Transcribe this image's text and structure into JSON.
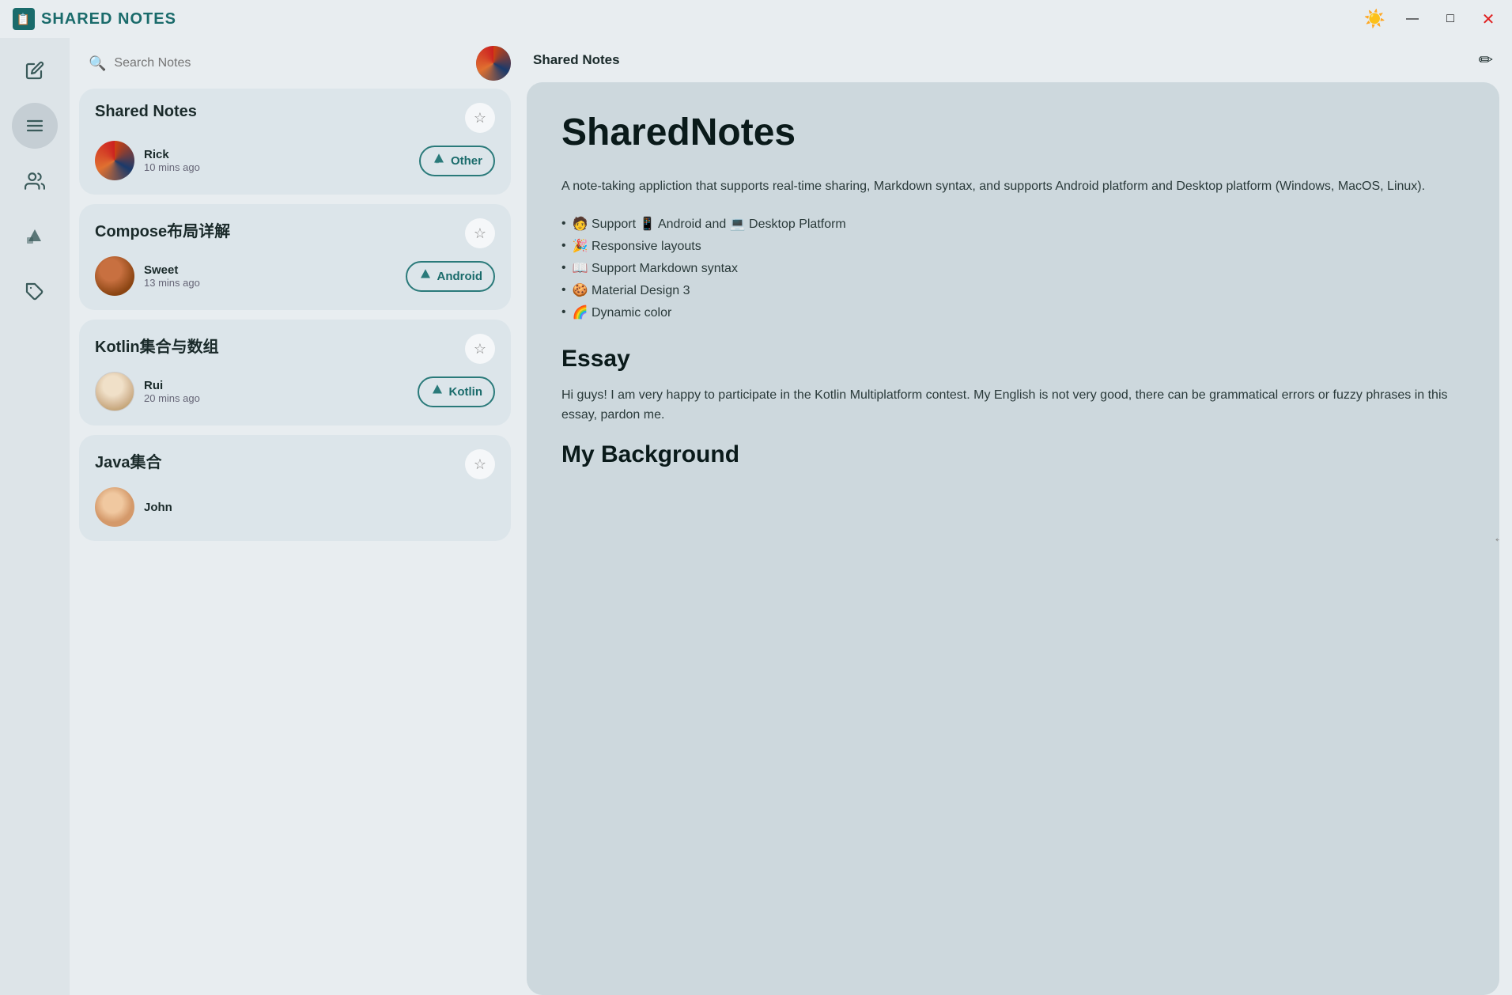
{
  "titleBar": {
    "title": "SHARED NOTES",
    "controls": {
      "minimize": "—",
      "maximize": "□",
      "close": "✕"
    }
  },
  "sidebar": {
    "items": [
      {
        "name": "edit-icon",
        "icon": "✏️",
        "active": false
      },
      {
        "name": "notes-list-icon",
        "icon": "☰",
        "active": true
      },
      {
        "name": "people-icon",
        "icon": "👥",
        "active": false
      },
      {
        "name": "shapes-icon",
        "icon": "🔺",
        "active": false
      },
      {
        "name": "tag-icon",
        "icon": "🏷️",
        "active": false
      }
    ]
  },
  "search": {
    "placeholder": "Search Notes"
  },
  "notes": [
    {
      "id": "note-1",
      "title": "Shared Notes",
      "author": "Rick",
      "time": "10 mins ago",
      "tag": "Other",
      "avatarClass": "avatar-rick",
      "active": true
    },
    {
      "id": "note-2",
      "title": "Compose布局详解",
      "author": "Sweet",
      "time": "13 mins ago",
      "tag": "Android",
      "avatarClass": "avatar-sweet",
      "active": false
    },
    {
      "id": "note-3",
      "title": "Kotlin集合与数组",
      "author": "Rui",
      "time": "20 mins ago",
      "tag": "Kotlin",
      "avatarClass": "avatar-rui",
      "active": false
    },
    {
      "id": "note-4",
      "title": "Java集合",
      "author": "John",
      "time": "",
      "tag": "",
      "avatarClass": "avatar-john",
      "active": false
    }
  ],
  "content": {
    "header": "Shared Notes",
    "editIcon": "✏",
    "title": "SharedNotes",
    "description": "A note-taking appliction that supports real-time sharing, Markdown syntax, and supports Android platform and Desktop platform (Windows, MacOS, Linux).",
    "features": [
      "🧑 Support 📱 Android and 💻 Desktop Platform",
      "🎉 Responsive layouts",
      "📖 Support Markdown syntax",
      "🍪 Material Design 3",
      "🌈 Dynamic color"
    ],
    "essayTitle": "Essay",
    "essayBody": "Hi guys! I am very happy to participate in the Kotlin Multiplatform contest. My English is not very good, there can be grammatical errors or fuzzy phrases in this essay, pardon me.",
    "backgroundTitle": "My Background"
  }
}
